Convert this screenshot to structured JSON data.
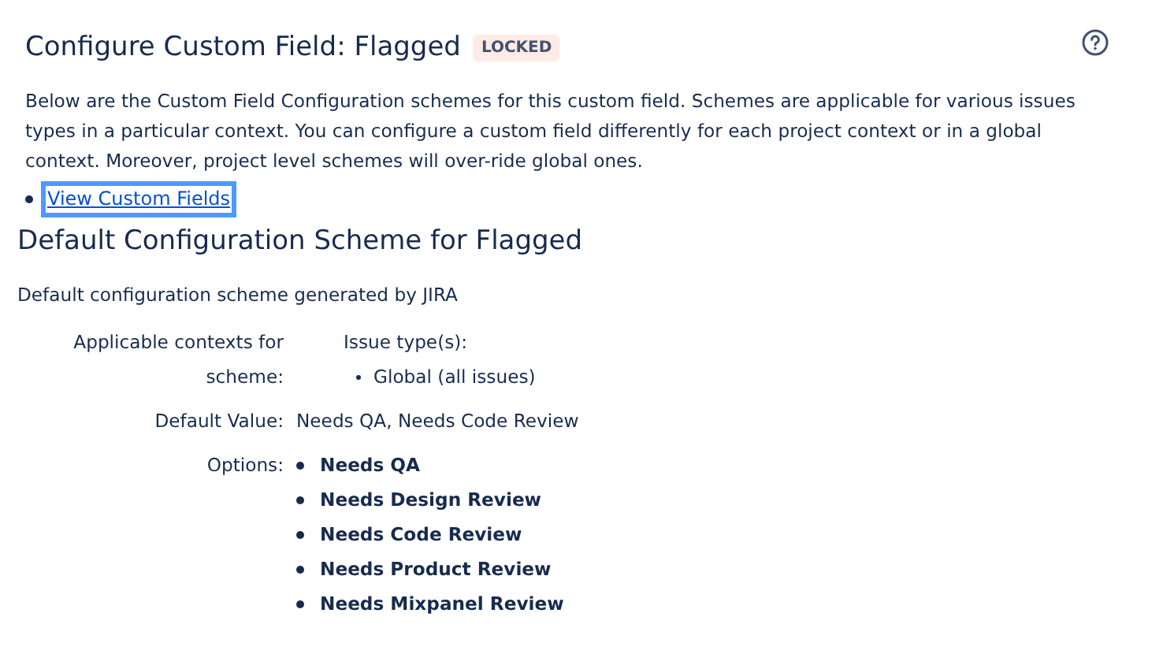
{
  "title": "Configure Custom Field: Flagged",
  "badge": "LOCKED",
  "description": "Below are the Custom Field Configuration schemes for this custom field. Schemes are applicable for various issues types in a particular context. You can configure a custom field differently for each project context or in a global context. Moreover, project level schemes will over-ride global ones.",
  "links": [
    {
      "label": "View Custom Fields",
      "focused": true
    }
  ],
  "scheme": {
    "title": "Default Configuration Scheme for Flagged",
    "description": "Default configuration scheme generated by JIRA",
    "contexts_label": "Applicable contexts for scheme:",
    "issue_types_label": "Issue type(s):",
    "issue_types": [
      "Global (all issues)"
    ],
    "default_value_label": "Default Value:",
    "default_value": "Needs QA, Needs Code Review",
    "options_label": "Options:",
    "options": [
      "Needs QA",
      "Needs Design Review",
      "Needs Code Review",
      "Needs Product Review",
      "Needs Mixpanel Review"
    ]
  }
}
